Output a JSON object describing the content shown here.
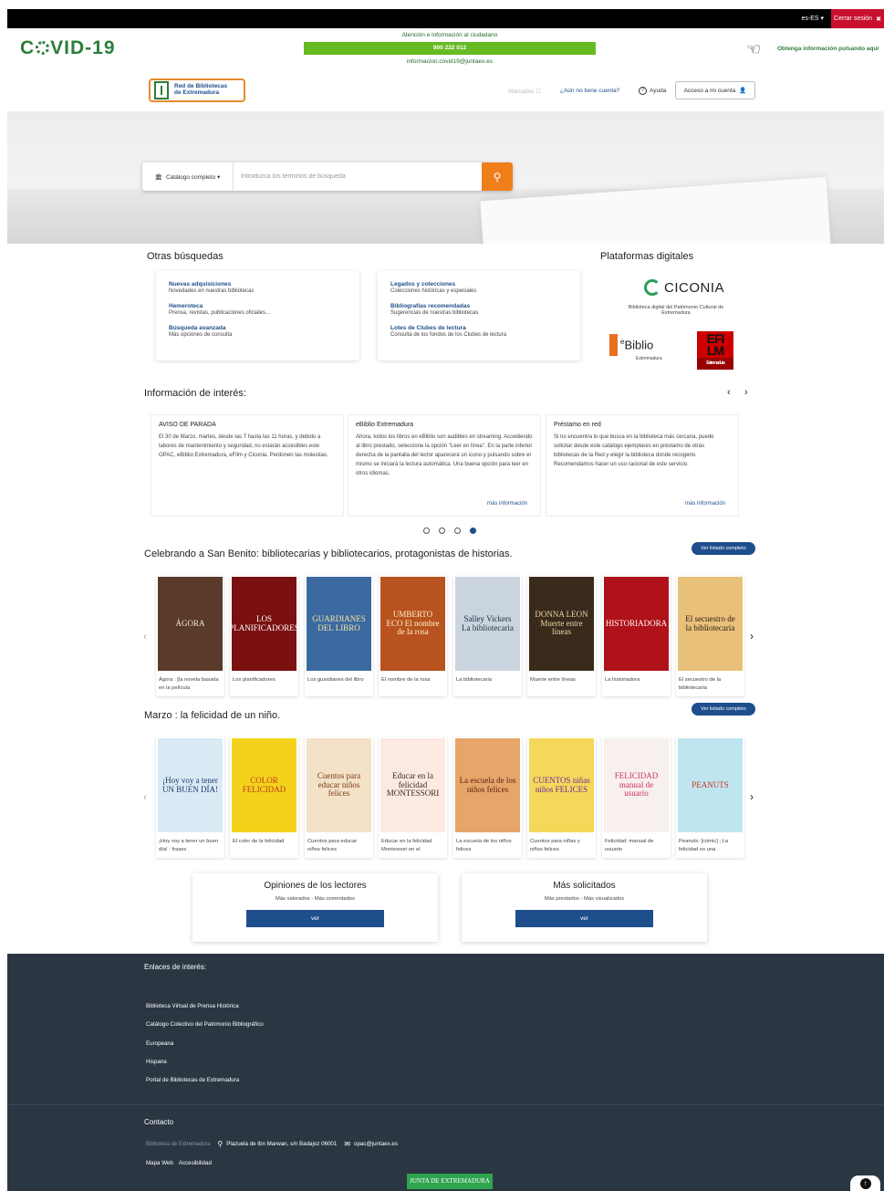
{
  "topbar": {
    "lang": "es-ES ▾",
    "logout": "Cerrar sesión",
    "logout_icon": "✖"
  },
  "covid": {
    "logo_left": "C",
    "logo_right": "VID-19",
    "attention": "Atención e información al ciudadano",
    "phone": "900 222 012",
    "email": "informacion.covid19@juntaex.es",
    "info": "Obtenga información pulsando aquí"
  },
  "header": {
    "logo_line1": "Red de Bibliotecas",
    "logo_line2": "de Extremadura",
    "marcados": "Marcados ☐",
    "no_account": "¿Aún no tiene cuenta?",
    "help": "Ayuda",
    "login": "Acceso a mi cuenta"
  },
  "search": {
    "scope": "Catálogo completo ▾",
    "placeholder": "Introduzca los términos de búsqueda"
  },
  "other_searches": {
    "title": "Otras búsquedas",
    "col1": [
      {
        "title": "Nuevas adquisiciones",
        "desc": "Novedades en nuestras bibliotecas"
      },
      {
        "title": "Hemeroteca",
        "desc": "Prensa, revistas, publicaciones oficiales..."
      },
      {
        "title": "Búsqueda avanzada",
        "desc": "Más opciones de consulta"
      }
    ],
    "col2": [
      {
        "title": "Legados y colecciones",
        "desc": "Colecciones históricas y especiales"
      },
      {
        "title": "Bibliografías recomendadas",
        "desc": "Sugerencias de nuestras bibliotecas"
      },
      {
        "title": "Lotes de Clubes de lectura",
        "desc": "Consulta de los fondos de los Clubes de lectura"
      }
    ]
  },
  "platforms": {
    "title": "Plataformas digitales",
    "ciconia": "CICONIA",
    "ciconia_desc": "Biblioteca digital del Patrimonio Cultural de Extremadura",
    "eb_prefix": "e",
    "eb_name": "Biblio",
    "eb_sub": "Extremadura",
    "efilm_top": "EFI",
    "efilm_mid": "LM",
    "efilm_sub": "Extremadura"
  },
  "info": {
    "title": "Información de interés:",
    "cards": [
      {
        "title": "AVISO DE PARADA",
        "body": "El 30 de Marzo, martes, desde las 7 hasta las 11 horas, y debido a labores de mantenimiento y seguridad, no estarán accesibles este OPAC, eBiblio Extremadura, eFilm y Ciconia. Perdonen las molestias.",
        "more": ""
      },
      {
        "title": "eBiblio Extremadura",
        "body": "Ahora, todos los libros en eBiblio son audibles en streaming. Accediendo al libro prestado, seleccione la opción \"Leer en línea\". En la parte inferior derecha de la pantalla del lector aparecerá un icono y pulsando sobre el mismo se iniciará la lectura automática. Una buena opción para leer en otros idiomas.",
        "more": "más información"
      },
      {
        "title": "Préstamo en red",
        "body": "Si no encuentra lo que busca en la biblioteca más cercana, puede solicitar desde este catálogo ejemplares en préstamo de otras bibliotecas de la Red y elegir la biblioteca donde recogerlo. Recomendamos hacer un uso racional de este servicio.",
        "more": "más información"
      }
    ],
    "dots_total": 4,
    "dots_active": 4
  },
  "carousel1": {
    "title": "Celebrando a San Benito: bibliotecarias y bibliotecarios, protagonistas de historias.",
    "button": "Ver listado completo",
    "books": [
      {
        "cover": "ÁGORA",
        "title": "Ágora : [la novela basada en la película",
        "bg": "#5a3a2a",
        "fg": "#f0e6d8"
      },
      {
        "cover": "LOS PLANIFICADORES",
        "title": "Los planificadores",
        "bg": "#7a1010",
        "fg": "#ffffff"
      },
      {
        "cover": "GUARDIANES DEL LIBRO",
        "title": "Los guardianes del libro",
        "bg": "#3b6aa0",
        "fg": "#f5e3a0"
      },
      {
        "cover": "UMBERTO ECO El nombre de la rosa",
        "title": "El nombre de la rosa",
        "bg": "#b8521e",
        "fg": "#fff4d0"
      },
      {
        "cover": "Salley Vickers La bibliotecaria",
        "title": "La bibliotecaria",
        "bg": "#c9d4de",
        "fg": "#223344"
      },
      {
        "cover": "DONNA LEON Muerte entre líneas",
        "title": "Muerte entre líneas",
        "bg": "#3a2a1c",
        "fg": "#e8d5a6"
      },
      {
        "cover": "HISTORIADORA",
        "title": "La historiadora",
        "bg": "#b0121a",
        "fg": "#ffffff"
      },
      {
        "cover": "El secuestro de la bibliotecaria",
        "title": "El secuestro de la bibliotecaria",
        "bg": "#e9c07a",
        "fg": "#2a1a10"
      }
    ]
  },
  "carousel2": {
    "title": "Marzo : la felicidad de un niño.",
    "button": "Ver listado completo",
    "books": [
      {
        "cover": "¡Hoy voy a tener UN BUEN DÍA!",
        "title": "¡Hoy voy a tener un buen día! : frases",
        "bg": "#d9eaf5",
        "fg": "#1a3a6a"
      },
      {
        "cover": "COLOR FELICIDAD",
        "title": "El color de la felicidad",
        "bg": "#f4d21c",
        "fg": "#c0391b"
      },
      {
        "cover": "Cuentos para educar niños felices",
        "title": "Cuentos para educar niños felices",
        "bg": "#f3e2c8",
        "fg": "#7a3a10"
      },
      {
        "cover": "Educar en la felicidad MONTESSORI",
        "title": "Educar en la felicidad Montessori en el",
        "bg": "#fbe9e2",
        "fg": "#3a2a20"
      },
      {
        "cover": "La escuela de los niños felices",
        "title": "La escuela de los niños felices",
        "bg": "#e8a56a",
        "fg": "#5a1f10"
      },
      {
        "cover": "CUENTOS niñas niños FELICES",
        "title": "Cuentos para niñas y niños felices",
        "bg": "#f5d85a",
        "fg": "#6a2aa0"
      },
      {
        "cover": "FELICIDAD manual de usuario",
        "title": "Felicidad: manual de usuario",
        "bg": "#f7f0ee",
        "fg": "#d0315a"
      },
      {
        "cover": "PEANUTS",
        "title": "Peanuts: [cómic] ; La felicidad es una",
        "bg": "#bfe5f0",
        "fg": "#d4321c"
      }
    ]
  },
  "opinions": {
    "title": "Opiniones de los lectores",
    "links": "Más valorados - Más comentados",
    "button": "ver"
  },
  "requested": {
    "title": "Más solicitados",
    "links": "Más prestados - Más visualizados",
    "button": "ver"
  },
  "footer": {
    "links_title": "Enlaces de interés:",
    "links": [
      "Biblioteca Virtual de Prensa Histórica",
      "Catálogo Colectivo del Patrimonio Bibliográfico",
      "Europeana",
      "Hispana",
      "Portal de Bibliotecas de Extremadura"
    ],
    "contact_title": "Contacto",
    "contact_org": "Biblioteca de Extremadura",
    "contact_address": "Plazuela de Ibn Marwan, s/n Badajoz 06001",
    "contact_email": "opac@juntaex.es",
    "sitemap": "Mapa Web",
    "accessibility": "Accesibilidad",
    "junta": "JUNTA DE EXTREMADURA"
  },
  "colors": {
    "accent": "#1f4e8c",
    "search_button": "#f07e1a",
    "covid_green": "#66bb22",
    "logout": "#c8102e",
    "footer": "#2b3643"
  }
}
